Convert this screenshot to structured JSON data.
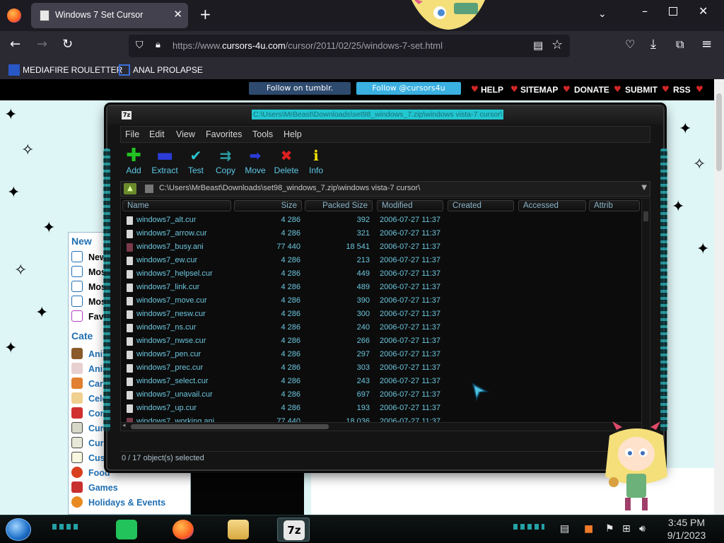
{
  "browser": {
    "tab": {
      "title": "Windows 7 Set Cursor"
    },
    "url": {
      "prefix": "https://www.",
      "host": "cursors-4u.com",
      "path": "/cursor/2011/02/25/windows-7-set.html"
    },
    "bookmarks": [
      {
        "label": "MEDIAFIRE ROULETTER"
      },
      {
        "label": "ANAL PROLAPSE"
      }
    ]
  },
  "webpage": {
    "follow_tumblr": "Follow on tumblr.",
    "follow_twitter": "Follow @cursors4u",
    "nav": [
      "HELP",
      "SITEMAP",
      "DONATE",
      "SUBMIT",
      "RSS"
    ],
    "new_heading": "New",
    "new_items": [
      "New",
      "Mos",
      "Mos",
      "Mos",
      "Favo"
    ],
    "cat_heading": "Cate",
    "categories": [
      "Anim",
      "Anim",
      "Cart",
      "Cele",
      "Com",
      "Curs",
      "Curs",
      "Cus",
      "Food",
      "Games",
      "Holidays & Events"
    ]
  },
  "zip": {
    "title": "C:\\Users\\MrBeast\\Downloads\\set98_windows_7.zip\\windows vista-7 cursor\\",
    "menu": [
      "File",
      "Edit",
      "View",
      "Favorites",
      "Tools",
      "Help"
    ],
    "toolbar": [
      {
        "label": "Add",
        "icon": "plus-icon",
        "color": "#22c322"
      },
      {
        "label": "Extract",
        "icon": "minus-icon",
        "color": "#2b3cd8"
      },
      {
        "label": "Test",
        "icon": "check-icon",
        "color": "#29c6cc"
      },
      {
        "label": "Copy",
        "icon": "double-arrow-icon",
        "color": "#29a0a6"
      },
      {
        "label": "Move",
        "icon": "arrow-right-icon",
        "color": "#2b3cd8"
      },
      {
        "label": "Delete",
        "icon": "x-icon",
        "color": "#e02020"
      },
      {
        "label": "Info",
        "icon": "info-icon",
        "color": "#f2e200"
      }
    ],
    "path": "C:\\Users\\MrBeast\\Downloads\\set98_windows_7.zip\\windows vista-7 cursor\\",
    "columns": [
      "Name",
      "Size",
      "Packed Size",
      "Modified",
      "Created",
      "Accessed",
      "Attrib"
    ],
    "files": [
      {
        "name": "windows7_alt.cur",
        "size": "4 286",
        "packed": "392",
        "modified": "2006-07-27 11:37"
      },
      {
        "name": "windows7_arrow.cur",
        "size": "4 286",
        "packed": "321",
        "modified": "2006-07-27 11:37"
      },
      {
        "name": "windows7_busy.ani",
        "size": "77 440",
        "packed": "18 541",
        "modified": "2006-07-27 11:37"
      },
      {
        "name": "windows7_ew.cur",
        "size": "4 286",
        "packed": "213",
        "modified": "2006-07-27 11:37"
      },
      {
        "name": "windows7_helpsel.cur",
        "size": "4 286",
        "packed": "449",
        "modified": "2006-07-27 11:37"
      },
      {
        "name": "windows7_link.cur",
        "size": "4 286",
        "packed": "489",
        "modified": "2006-07-27 11:37"
      },
      {
        "name": "windows7_move.cur",
        "size": "4 286",
        "packed": "390",
        "modified": "2006-07-27 11:37"
      },
      {
        "name": "windows7_nesw.cur",
        "size": "4 286",
        "packed": "300",
        "modified": "2006-07-27 11:37"
      },
      {
        "name": "windows7_ns.cur",
        "size": "4 286",
        "packed": "240",
        "modified": "2006-07-27 11:37"
      },
      {
        "name": "windows7_nwse.cur",
        "size": "4 286",
        "packed": "266",
        "modified": "2006-07-27 11:37"
      },
      {
        "name": "windows7_pen.cur",
        "size": "4 286",
        "packed": "297",
        "modified": "2006-07-27 11:37"
      },
      {
        "name": "windows7_prec.cur",
        "size": "4 286",
        "packed": "303",
        "modified": "2006-07-27 11:37"
      },
      {
        "name": "windows7_select.cur",
        "size": "4 286",
        "packed": "243",
        "modified": "2006-07-27 11:37"
      },
      {
        "name": "windows7_unavail.cur",
        "size": "4 286",
        "packed": "697",
        "modified": "2006-07-27 11:37"
      },
      {
        "name": "windows7_up.cur",
        "size": "4 286",
        "packed": "193",
        "modified": "2006-07-27 11:37"
      },
      {
        "name": "windows7_working.ani",
        "size": "77 440",
        "packed": "18 036",
        "modified": "2006-07-27 11:37"
      }
    ],
    "status": "0 / 17 object(s) selected"
  },
  "taskbar": {
    "time": "3:45 PM",
    "date": "9/1/2023"
  }
}
